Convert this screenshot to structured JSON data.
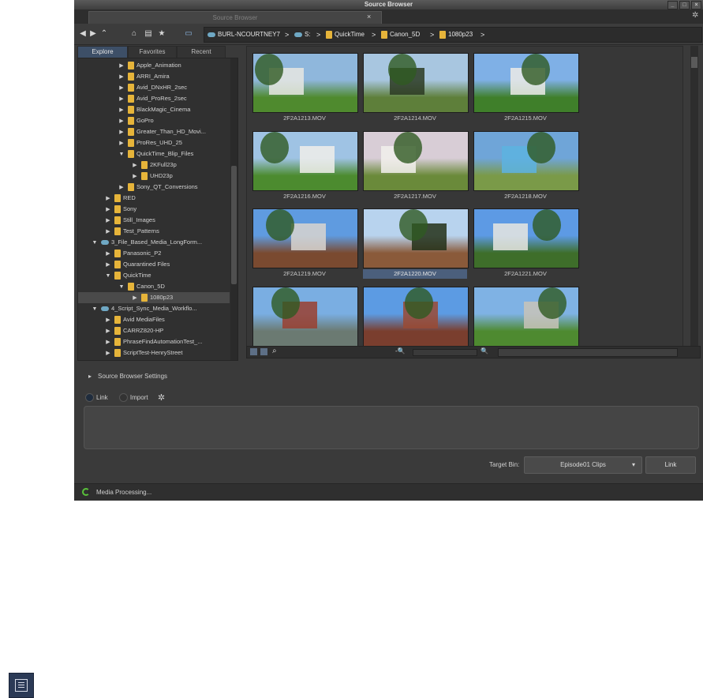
{
  "window": {
    "title": "Source Browser"
  },
  "tab": {
    "label": "Source Browser",
    "close": "×"
  },
  "breadcrumb": {
    "items": [
      "BURL-NCOURTNEY7",
      "S:",
      "QuickTime",
      "Canon_5D",
      "1080p23"
    ],
    "separator": ">"
  },
  "left_tabs": [
    "Explore",
    "Favorites",
    "Recent"
  ],
  "tree": [
    {
      "label": "Apple_Animation",
      "indent": 3,
      "expanded": false,
      "type": "folder"
    },
    {
      "label": "ARRI_Amira",
      "indent": 3,
      "expanded": false,
      "type": "folder"
    },
    {
      "label": "Avid_DNxHR_2sec",
      "indent": 3,
      "expanded": false,
      "type": "folder"
    },
    {
      "label": "Avid_ProRes_2sec",
      "indent": 3,
      "expanded": false,
      "type": "folder"
    },
    {
      "label": "BlackMagic_Cinema",
      "indent": 3,
      "expanded": false,
      "type": "folder"
    },
    {
      "label": "GoPro",
      "indent": 3,
      "expanded": false,
      "type": "folder"
    },
    {
      "label": "Greater_Than_HD_Movi...",
      "indent": 3,
      "expanded": false,
      "type": "folder"
    },
    {
      "label": "ProRes_UHD_25",
      "indent": 3,
      "expanded": false,
      "type": "folder"
    },
    {
      "label": "QuickTime_Blip_Files",
      "indent": 3,
      "expanded": true,
      "type": "folder"
    },
    {
      "label": "2KFull23p",
      "indent": 4,
      "expanded": false,
      "type": "folder"
    },
    {
      "label": "UHD23p",
      "indent": 4,
      "expanded": false,
      "type": "folder"
    },
    {
      "label": "Sony_QT_Conversions",
      "indent": 3,
      "expanded": false,
      "type": "folder"
    },
    {
      "label": "RED",
      "indent": 2,
      "expanded": false,
      "type": "folder"
    },
    {
      "label": "Sony",
      "indent": 2,
      "expanded": false,
      "type": "folder"
    },
    {
      "label": "Still_Images",
      "indent": 2,
      "expanded": false,
      "type": "folder"
    },
    {
      "label": "Test_Patterns",
      "indent": 2,
      "expanded": false,
      "type": "folder"
    },
    {
      "label": "3_File_Based_Media_LongForm...",
      "indent": 1,
      "expanded": true,
      "type": "drive"
    },
    {
      "label": "Panasonic_P2",
      "indent": 2,
      "expanded": false,
      "type": "folder"
    },
    {
      "label": "Quarantined Files",
      "indent": 2,
      "expanded": false,
      "type": "folder"
    },
    {
      "label": "QuickTime",
      "indent": 2,
      "expanded": true,
      "type": "folder"
    },
    {
      "label": "Canon_5D",
      "indent": 3,
      "expanded": true,
      "type": "folder"
    },
    {
      "label": "1080p23",
      "indent": 4,
      "expanded": false,
      "type": "folder",
      "selected": true
    },
    {
      "label": "4_Script_Sync_Media_Workflo...",
      "indent": 1,
      "expanded": true,
      "type": "drive"
    },
    {
      "label": "Avid MediaFiles",
      "indent": 2,
      "expanded": false,
      "type": "folder"
    },
    {
      "label": "CARRZ820-HP",
      "indent": 2,
      "expanded": false,
      "type": "folder"
    },
    {
      "label": "PhraseFindAutomationTest_...",
      "indent": 2,
      "expanded": false,
      "type": "folder"
    },
    {
      "label": "ScriptTest-HenryStreet",
      "indent": 2,
      "expanded": false,
      "type": "folder"
    }
  ],
  "clips": [
    {
      "name": "2F2A1213.MOV",
      "sky": "#8fb7dc",
      "ground": "#4f8a2e",
      "accent": "#e8e8e2"
    },
    {
      "name": "2F2A1214.MOV",
      "sky": "#a8c6e0",
      "ground": "#5e7f3a",
      "accent": "#2b3a22"
    },
    {
      "name": "2F2A1215.MOV",
      "sky": "#7fb0e6",
      "ground": "#3f7f2a",
      "accent": "#ecebe6"
    },
    {
      "name": "2F2A1216.MOV",
      "sky": "#9fc3e4",
      "ground": "#4c8b2f",
      "accent": "#f0efea"
    },
    {
      "name": "2F2A1217.MOV",
      "sky": "#d8cdd6",
      "ground": "#6a8a3a",
      "accent": "#f2f0ec"
    },
    {
      "name": "2F2A1218.MOV",
      "sky": "#6fa5d8",
      "ground": "#7a9a48",
      "accent": "#5db3e0"
    },
    {
      "name": "2F2A1219.MOV",
      "sky": "#5f9be0",
      "ground": "#7a4a30",
      "accent": "#d9d5cf"
    },
    {
      "name": "2F2A1220.MOV",
      "sky": "#b8d3ee",
      "ground": "#8a5a3a",
      "accent": "#233018",
      "selected": true
    },
    {
      "name": "2F2A1221.MOV",
      "sky": "#5d9ae4",
      "ground": "#3e6e2a",
      "accent": "#e8e6e0"
    },
    {
      "name": "",
      "sky": "#7aaee2",
      "ground": "#6b7a72",
      "accent": "#9a4030"
    },
    {
      "name": "",
      "sky": "#5c9be3",
      "ground": "#7a3e2e",
      "accent": "#9a4a34"
    },
    {
      "name": "",
      "sky": "#7fb2e4",
      "ground": "#4e8a30",
      "accent": "#c8c3b8"
    }
  ],
  "settings": {
    "label": "Source Browser Settings"
  },
  "mode": {
    "link": "Link",
    "import": "Import"
  },
  "target": {
    "label": "Target Bin:",
    "value": "Episode01 Clips",
    "button": "Link"
  },
  "status": {
    "text": "Media Processing..."
  },
  "colors": {
    "accent": "#4b5f7c",
    "folder": "#e6b43a",
    "progress": "#59c23a"
  }
}
